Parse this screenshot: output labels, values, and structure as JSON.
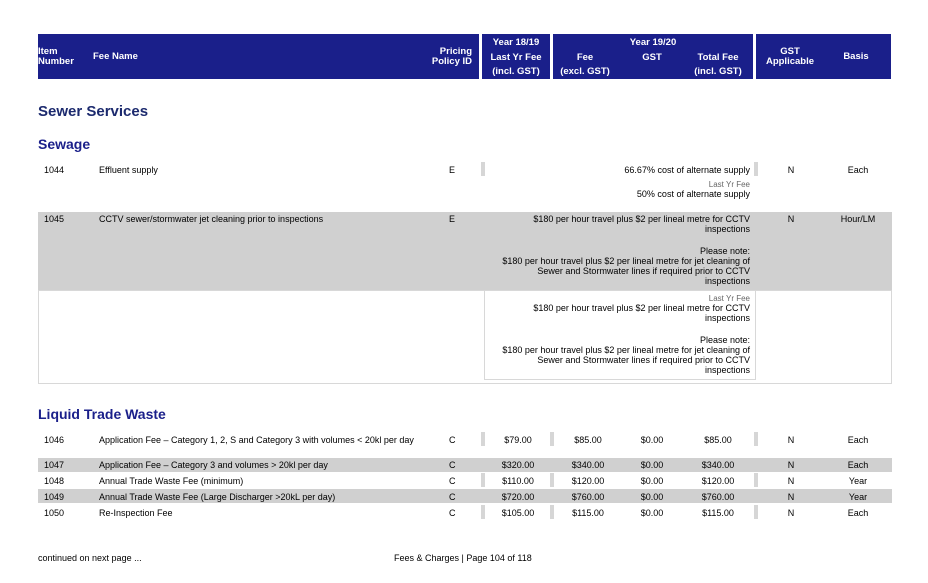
{
  "header": {
    "item_number": [
      "Item",
      "Number"
    ],
    "fee_name": "Fee Name",
    "pricing_policy": [
      "Pricing",
      "Policy ID"
    ],
    "year_prev": "Year 18/19",
    "last_yr_fee": [
      "Last Yr Fee",
      "(incl. GST)"
    ],
    "year_curr": "Year 19/20",
    "fee_excl": [
      "Fee",
      "(excl. GST)"
    ],
    "gst": "GST",
    "total_fee": [
      "Total Fee",
      "(incl. GST)"
    ],
    "gst_applicable": [
      "GST",
      "Applicable"
    ],
    "basis": "Basis"
  },
  "section_title": "Sewer Services",
  "sewage": {
    "title": "Sewage",
    "rows": [
      {
        "item": "1044",
        "name": "Effluent supply",
        "policy": "E",
        "fee_text": "66.67% cost of alternate supply",
        "last_yr_label": "Last Yr Fee",
        "last_yr_text": "50% cost of alternate supply",
        "gst_applicable": "N",
        "basis": "Each"
      },
      {
        "item": "1045",
        "name": "CCTV sewer/stormwater jet cleaning prior to inspections",
        "policy": "E",
        "fee_text": "$180 per hour travel plus $2 per lineal metre for CCTV inspections",
        "fee_note_label": "Please note:",
        "fee_note": "$180 per hour travel plus $2 per lineal metre for jet cleaning of Sewer and Stormwater lines if required prior to CCTV inspections",
        "last_yr_label": "Last Yr Fee",
        "last_yr_text": "$180 per hour travel plus $2 per lineal metre for CCTV inspections",
        "last_yr_note_label": "Please note:",
        "last_yr_note": "$180 per hour travel plus $2 per lineal metre for jet cleaning of Sewer and Stormwater lines if required prior to CCTV inspections",
        "gst_applicable": "N",
        "basis": "Hour/LM"
      }
    ]
  },
  "liquid_trade_waste": {
    "title": "Liquid Trade Waste",
    "rows": [
      {
        "item": "1046",
        "name": "Application Fee – Category 1, 2, S and Category 3 with volumes < 20kl per day",
        "policy": "C",
        "last_yr": "$79.00",
        "fee": "$85.00",
        "gst": "$0.00",
        "total": "$85.00",
        "gst_applicable": "N",
        "basis": "Each"
      },
      {
        "item": "1047",
        "name": "Application Fee – Category 3 and volumes > 20kl per day",
        "policy": "C",
        "last_yr": "$320.00",
        "fee": "$340.00",
        "gst": "$0.00",
        "total": "$340.00",
        "gst_applicable": "N",
        "basis": "Each"
      },
      {
        "item": "1048",
        "name": "Annual Trade Waste Fee (minimum)",
        "policy": "C",
        "last_yr": "$110.00",
        "fee": "$120.00",
        "gst": "$0.00",
        "total": "$120.00",
        "gst_applicable": "N",
        "basis": "Year"
      },
      {
        "item": "1049",
        "name": "Annual Trade Waste Fee (Large Discharger >20kL per day)",
        "policy": "C",
        "last_yr": "$720.00",
        "fee": "$760.00",
        "gst": "$0.00",
        "total": "$760.00",
        "gst_applicable": "N",
        "basis": "Year"
      },
      {
        "item": "1050",
        "name": "Re-Inspection Fee",
        "policy": "C",
        "last_yr": "$105.00",
        "fee": "$115.00",
        "gst": "$0.00",
        "total": "$115.00",
        "gst_applicable": "N",
        "basis": "Each"
      }
    ]
  },
  "footer": {
    "continued": "continued on next page ...",
    "page": "Fees & Charges | Page 104 of 118"
  }
}
